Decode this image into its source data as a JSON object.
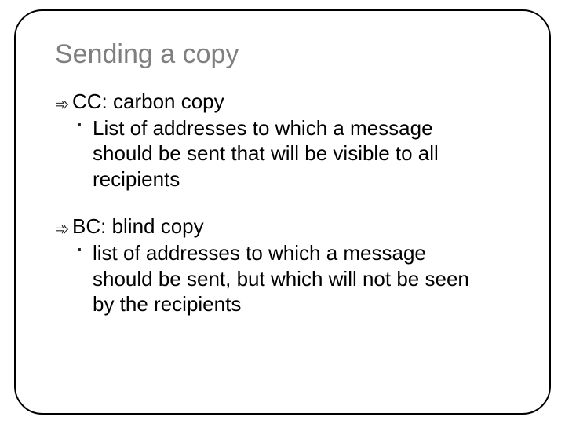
{
  "title": "Sending a copy",
  "items": [
    {
      "head": "CC: carbon copy",
      "sub": "List of addresses to which a message should be sent that will be visible to all recipients"
    },
    {
      "head": "BC: blind copy",
      "sub": " list of addresses to which a message should be sent, but which will not be seen by the recipients"
    }
  ]
}
